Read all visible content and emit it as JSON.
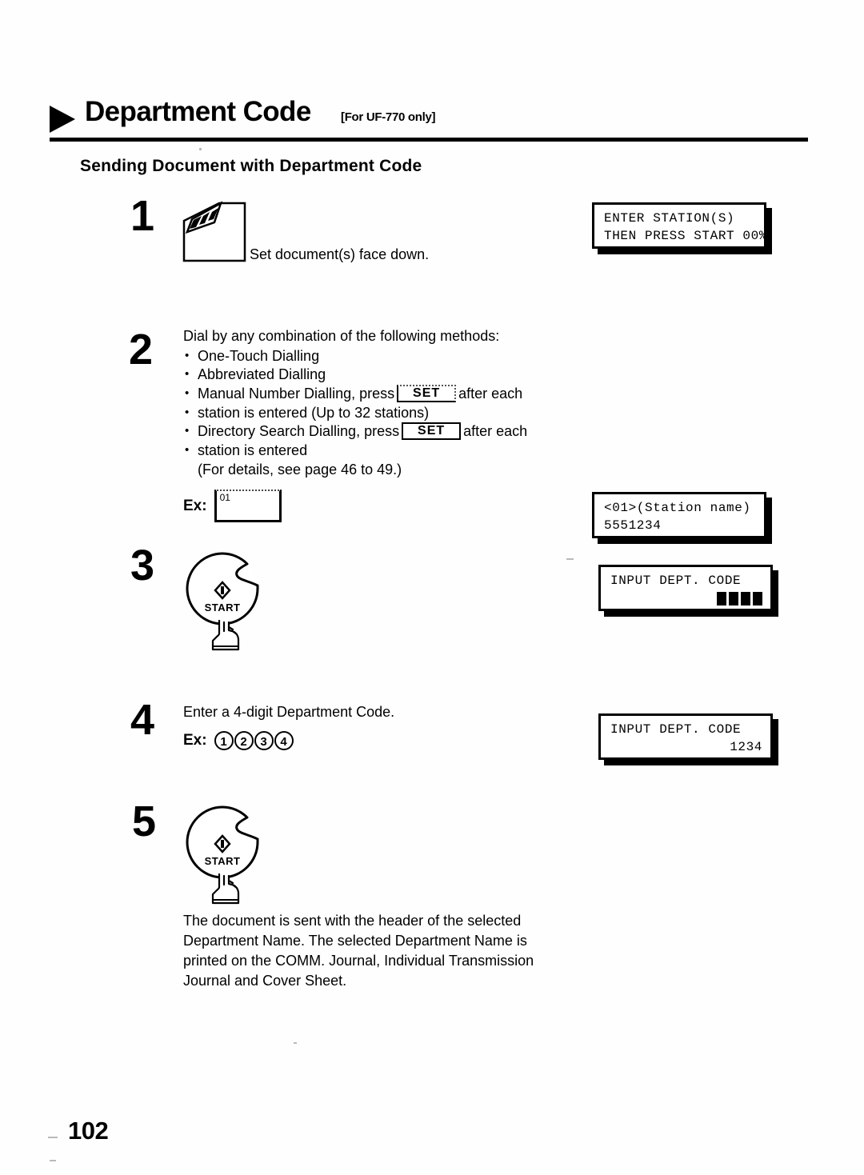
{
  "header": {
    "title": "Department Code",
    "subtitle": "[For UF-770 only]",
    "arrow_icon": "triangle-right-icon"
  },
  "section": {
    "heading": "Sending Document with Department Code"
  },
  "steps": [
    {
      "number": "1",
      "icon": "document-stack-icon",
      "caption": "Set document(s) face down."
    },
    {
      "number": "2",
      "lead": "Dial by any combination of the following methods:",
      "bullets": [
        {
          "text_before": "One-Touch Dialling",
          "key": null,
          "text_after": ""
        },
        {
          "text_before": "Abbreviated Dialling",
          "key": null,
          "text_after": ""
        },
        {
          "text_before": "Manual Number Dialling, press",
          "key": "SET",
          "text_after": "after each"
        },
        {
          "text_before": "Directory Search Dialling, press",
          "key": "SET",
          "text_after": "after each"
        }
      ],
      "cont_line_1": "station is entered (Up to 32 stations)",
      "cont_line_2": "station is entered",
      "note": "(For details, see page 46 to 49.)",
      "example_label": "Ex:",
      "example_key_id": "01"
    },
    {
      "number": "3",
      "button_label": "START",
      "button_icon": "start-diamond-icon",
      "hand_icon": "pressing-hand-icon"
    },
    {
      "number": "4",
      "instruction": "Enter a 4-digit Department Code.",
      "example_label": "Ex:",
      "example_digits": [
        "1",
        "2",
        "3",
        "4"
      ]
    },
    {
      "number": "5",
      "button_label": "START",
      "button_icon": "start-diamond-icon",
      "hand_icon": "pressing-hand-icon"
    }
  ],
  "closing": {
    "line1": "The document is sent with the header of the selected",
    "line2": "Department Name.  The selected Department Name is",
    "line3": "printed on the COMM. Journal, Individual Transmission",
    "line4": "Journal and Cover Sheet."
  },
  "displays": [
    {
      "name": "enter-stations",
      "line1": "ENTER STATION(S)",
      "line2": "THEN PRESS START 00%"
    },
    {
      "name": "station-selected",
      "line1": "<01>(Station name)",
      "line2": "5551234"
    },
    {
      "name": "input-dept-code-empty",
      "line1": "INPUT DEPT. CODE",
      "line2": ""
    },
    {
      "name": "input-dept-code-filled",
      "line1": "INPUT DEPT. CODE",
      "line2": "1234"
    }
  ],
  "footer": {
    "page_number": "102"
  }
}
